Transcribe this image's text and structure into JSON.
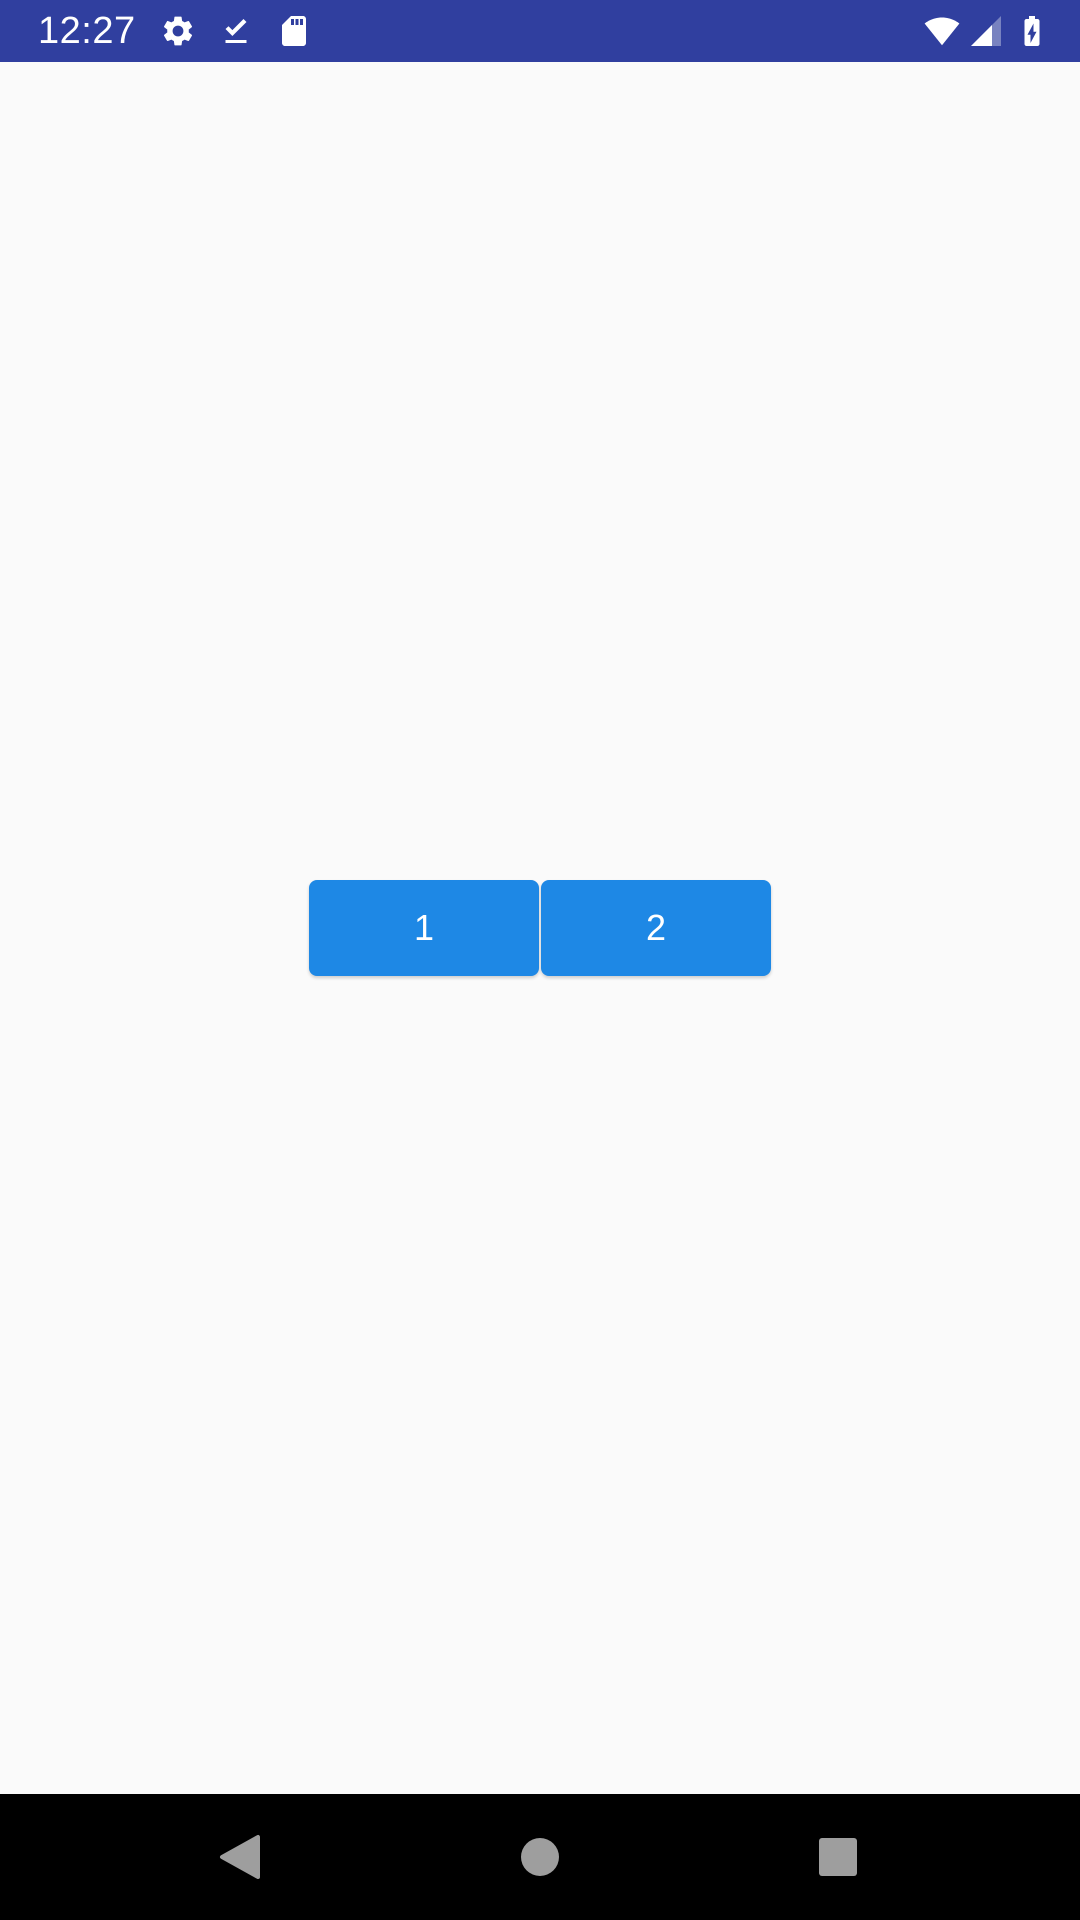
{
  "status_bar": {
    "time": "12:27",
    "background": "#303f9f",
    "left_icons": [
      "gear-icon",
      "download-done-icon",
      "sd-card-icon"
    ],
    "right_icons": [
      "wifi-icon",
      "cell-signal-icon",
      "battery-charging-icon"
    ]
  },
  "main": {
    "buttons": [
      {
        "label": "1"
      },
      {
        "label": "2"
      }
    ],
    "button_color": "#1e88e5"
  },
  "nav_bar": {
    "buttons": [
      "back-icon",
      "home-icon",
      "recents-icon"
    ],
    "icon_color": "#9e9e9e"
  }
}
